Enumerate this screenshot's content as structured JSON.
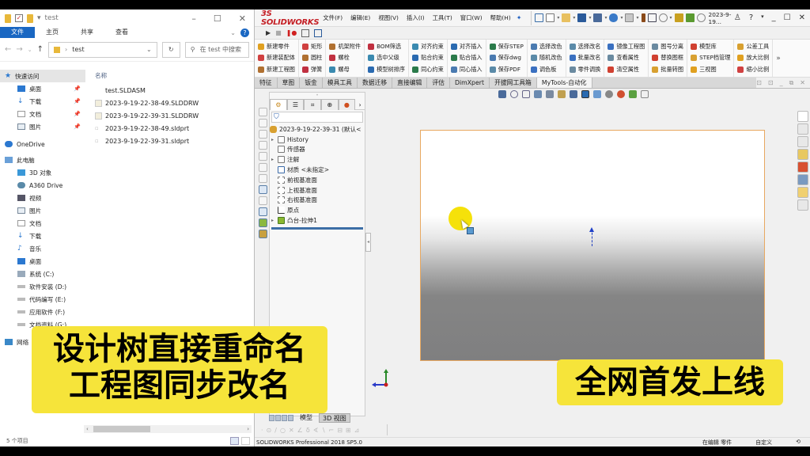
{
  "explorer": {
    "title": "test",
    "ribbon_tabs": [
      "文件",
      "主页",
      "共享",
      "查看"
    ],
    "address_path": "test",
    "search_placeholder": "在 test 中搜索",
    "nav": {
      "quick_access": "快速访问",
      "quick_items": [
        "桌面",
        "下载",
        "文档",
        "图片"
      ],
      "onedrive": "OneDrive",
      "this_pc": "此电脑",
      "pc_items": [
        "3D 对象",
        "A360 Drive",
        "视频",
        "图片",
        "文档",
        "下载",
        "音乐",
        "桌面",
        "系统 (C:)",
        "软件安装 (D:)",
        "代码编写 (E:)",
        "应用软件 (F:)",
        "文档资料 (G:)"
      ],
      "network": "网络"
    },
    "column_header": "名称",
    "files": [
      {
        "name": "test.SLDASM",
        "icon": "assembly-icon"
      },
      {
        "name": "2023-9-19-22-38-49.SLDDRW",
        "icon": "drawing-icon"
      },
      {
        "name": "2023-9-19-22-39-31.SLDDRW",
        "icon": "drawing-icon"
      },
      {
        "name": "2023-9-19-22-38-49.sldprt",
        "icon": "part-icon"
      },
      {
        "name": "2023-9-19-22-39-31.sldprt",
        "icon": "part-icon"
      }
    ],
    "status": "5 个项目"
  },
  "solidworks": {
    "logo": "SOLIDWORKS",
    "menu": [
      "文件(F)",
      "编辑(E)",
      "视图(V)",
      "插入(I)",
      "工具(T)",
      "窗口(W)",
      "帮助(H)"
    ],
    "doc_name": "2023-9-19...",
    "command_columns": [
      [
        "新建零件",
        "新建装配体",
        "新建工程图"
      ],
      [
        "矩形",
        "圆柱",
        "弹簧"
      ],
      [
        "机架附件",
        "螺栓",
        "螺母"
      ],
      [
        "BOM筛选",
        "选中父级",
        "模型树排序"
      ],
      [
        "对齐约束",
        "贴合约束",
        "同心约束"
      ],
      [
        "对齐插入",
        "贴合插入",
        "同心插入"
      ],
      [
        "保存STEP",
        "保存dwg",
        "保存PDF"
      ],
      [
        "选择改色",
        "随机改色",
        "调色板"
      ],
      [
        "选择改名",
        "批量改名",
        "零件调换"
      ],
      [
        "镜像工程图",
        "查看属性",
        "清空属性"
      ],
      [
        "图号分离",
        "替换图框",
        "批量转图"
      ],
      [
        "模型库",
        "STEP档管理",
        "三视图"
      ],
      [
        "公差工具",
        "放大比例",
        "缩小比例"
      ]
    ],
    "tabs": [
      "特征",
      "草图",
      "钣金",
      "模具工具",
      "数据迁移",
      "直接编辑",
      "评估",
      "DimXpert",
      "开拔网工具箱",
      "MyTools-自动化"
    ],
    "active_tab": "MyTools-自动化",
    "tree": {
      "root": "2023-9-19-22-39-31 (默认<",
      "items": [
        {
          "label": "History",
          "expandable": true
        },
        {
          "label": "传感器",
          "expandable": false
        },
        {
          "label": "注解",
          "expandable": true
        },
        {
          "label": "材质 <未指定>",
          "expandable": false
        },
        {
          "label": "前视基准面",
          "expandable": false
        },
        {
          "label": "上视基准面",
          "expandable": false
        },
        {
          "label": "右视基准面",
          "expandable": false
        },
        {
          "label": "原点",
          "expandable": false
        },
        {
          "label": "凸台-拉伸1",
          "expandable": true
        }
      ]
    },
    "model_tabs": [
      "模型",
      "3D 视图"
    ],
    "status_left": "SOLIDWORKS Professional 2018 SP5.0",
    "status_right": [
      "在编辑 零件",
      "自定义"
    ]
  },
  "captions": {
    "left_line1": "设计树直接重命名",
    "left_line2": "工程图同步改名",
    "right": "全网首发上线"
  },
  "colors": {
    "caption_bg": "#f6e43a",
    "explorer_accent": "#1a67c2",
    "sw_red": "#c41e24"
  }
}
